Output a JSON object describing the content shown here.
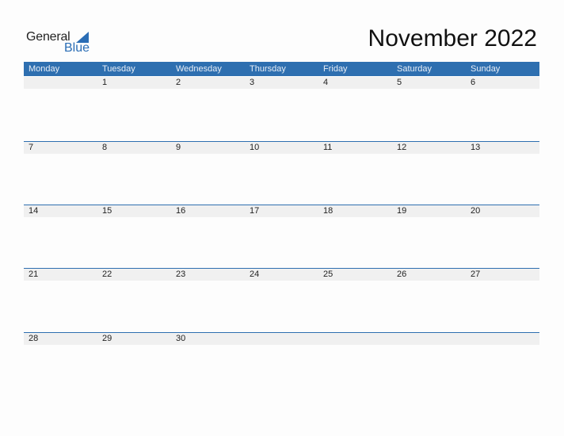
{
  "logo": {
    "general": "General",
    "blue": "Blue"
  },
  "title": "November 2022",
  "days": [
    "Monday",
    "Tuesday",
    "Wednesday",
    "Thursday",
    "Friday",
    "Saturday",
    "Sunday"
  ],
  "weeks": [
    [
      "",
      "1",
      "2",
      "3",
      "4",
      "5",
      "6"
    ],
    [
      "7",
      "8",
      "9",
      "10",
      "11",
      "12",
      "13"
    ],
    [
      "14",
      "15",
      "16",
      "17",
      "18",
      "19",
      "20"
    ],
    [
      "21",
      "22",
      "23",
      "24",
      "25",
      "26",
      "27"
    ],
    [
      "28",
      "29",
      "30",
      "",
      "",
      "",
      ""
    ]
  ],
  "colors": {
    "accent": "#2e6fb0",
    "strip": "#f0f0f0"
  }
}
